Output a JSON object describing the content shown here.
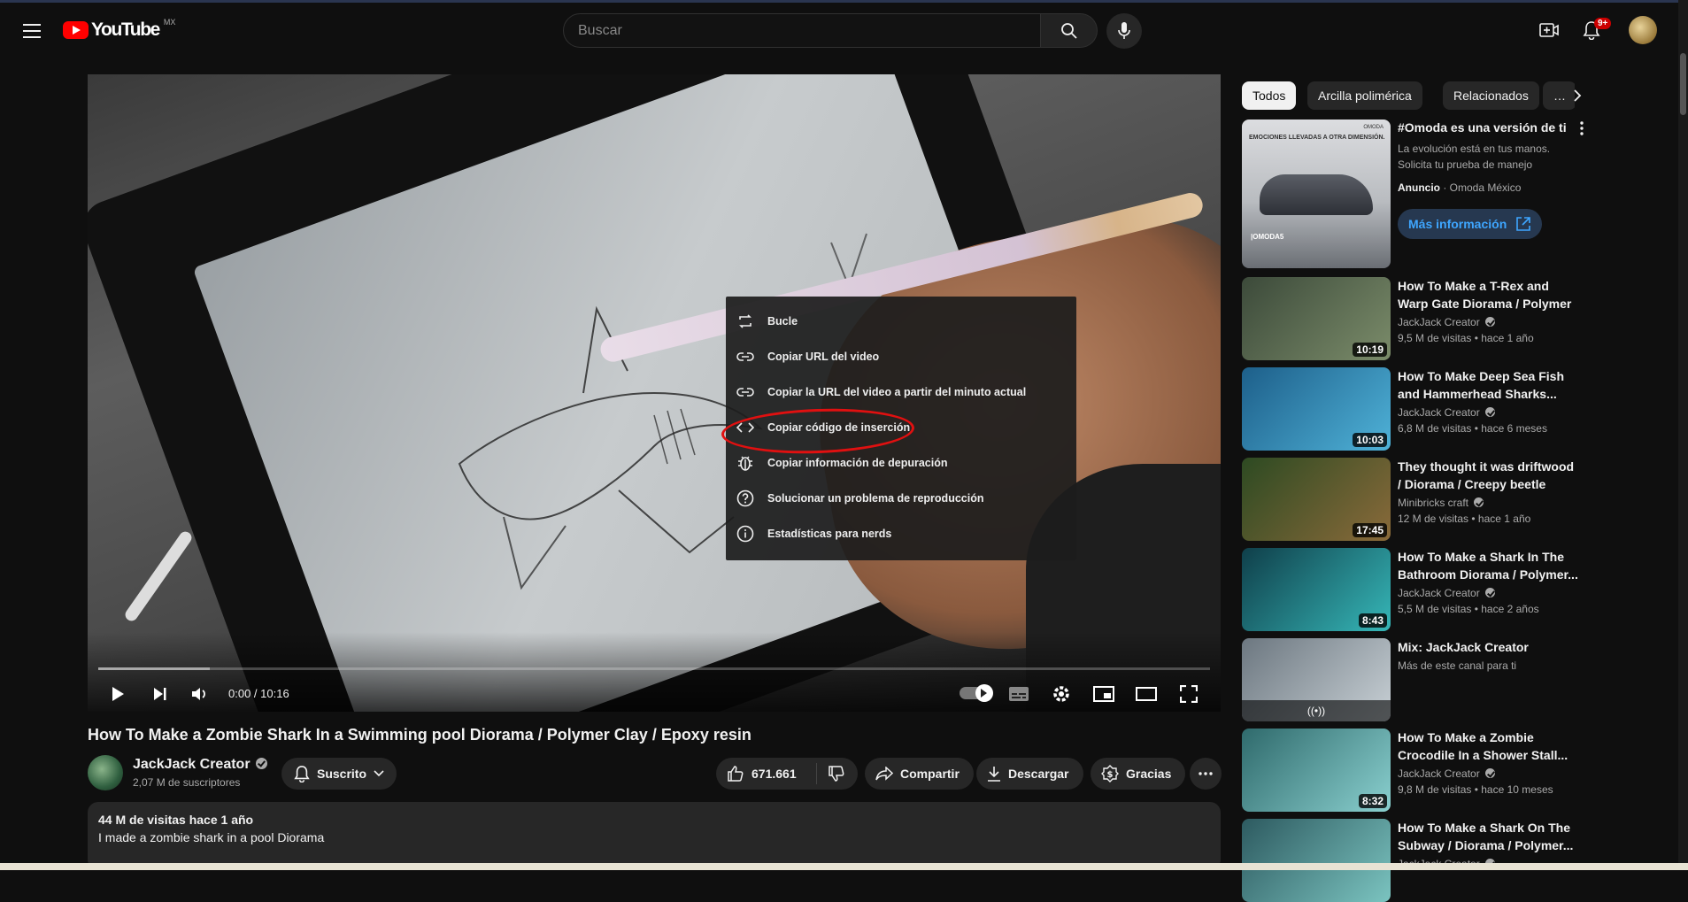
{
  "header": {
    "logo_text": "YouTube",
    "country_code": "MX",
    "search_placeholder": "Buscar",
    "notification_badge": "9+"
  },
  "player": {
    "time_current": "0:00",
    "time_separator": " / ",
    "time_total": "10:16",
    "progress_fraction": 0.0,
    "context_menu": [
      {
        "icon": "loop-icon",
        "label": "Bucle"
      },
      {
        "icon": "link-icon",
        "label": "Copiar URL del video"
      },
      {
        "icon": "link-icon",
        "label": "Copiar la URL del video a partir del minuto actual"
      },
      {
        "icon": "embed-code-icon",
        "label": "Copiar código de inserción"
      },
      {
        "icon": "debug-bug-icon",
        "label": "Copiar información de depuración"
      },
      {
        "icon": "help-circle-icon",
        "label": "Solucionar un problema de reproducción"
      },
      {
        "icon": "info-icon",
        "label": "Estadísticas para nerds"
      }
    ],
    "highlight_color": "#e01010"
  },
  "video": {
    "title": "How To Make a Zombie Shark In a Swimming pool Diorama / Polymer Clay / Epoxy resin",
    "channel": "JackJack Creator",
    "subscribers": "2,07 M de suscriptores",
    "subscribe_label": "Suscrito",
    "likes": "671.661",
    "share_label": "Compartir",
    "download_label": "Descargar",
    "thanks_label": "Gracias",
    "description_meta": "44 M de visitas  hace 1 año",
    "description_text": "I made a zombie shark in a pool Diorama"
  },
  "sidebar": {
    "chips": [
      "Todos",
      "Arcilla polimérica",
      "Relacionados",
      "…"
    ],
    "ad": {
      "title": "#Omoda es una versión de ti",
      "description": "La evolución está en tus manos. Solicita tu prueba de manejo",
      "label": "Anuncio",
      "advertiser": "Omoda México",
      "cta": "Más información",
      "thumb_tag": "EMOCIONES LLEVADAS A OTRA DIMENSIÓN.",
      "thumb_brand": "OMODA",
      "thumb_bottom": "|OMODA5"
    },
    "recommendations": [
      {
        "title": "How To Make a T-Rex and Warp Gate Diorama / Polymer Clay /...",
        "channel": "JackJack Creator",
        "verified": true,
        "meta": "9,5 M de visitas • hace 1 año",
        "duration": "10:19",
        "thumb_colors": [
          "#3c4a3a",
          "#7b8c6a"
        ]
      },
      {
        "title": "How To Make Deep Sea Fish and Hammerhead Sharks...",
        "channel": "JackJack Creator",
        "verified": true,
        "meta": "6,8 M de visitas • hace 6 meses",
        "duration": "10:03",
        "thumb_colors": [
          "#1d5f8a",
          "#4fb2d8"
        ]
      },
      {
        "title": "They thought it was driftwood / Diorama / Creepy beetle",
        "channel": "Minibricks craft",
        "verified": true,
        "meta": "12 M de visitas • hace 1 año",
        "duration": "17:45",
        "thumb_colors": [
          "#2d4a22",
          "#8a6a3a"
        ]
      },
      {
        "title": "How To Make a Shark In The Bathroom Diorama / Polymer...",
        "channel": "JackJack Creator",
        "verified": true,
        "meta": "5,5 M de visitas • hace 2 años",
        "duration": "8:43",
        "thumb_colors": [
          "#0f3f4a",
          "#36b7b8"
        ]
      },
      {
        "title": "Mix: JackJack Creator",
        "channel": "",
        "verified": false,
        "meta": "",
        "duration": "",
        "mix_sub": "Más de este canal para ti",
        "mix": true,
        "thumb_colors": [
          "#6c7780",
          "#c9d1d6"
        ]
      },
      {
        "title": "How To Make a Zombie Crocodile In a Shower Stall...",
        "channel": "JackJack Creator",
        "verified": true,
        "meta": "9,8 M de visitas • hace 10 meses",
        "duration": "8:32",
        "thumb_colors": [
          "#2f6a6c",
          "#8ad0cf"
        ]
      },
      {
        "title": "How To Make a Shark On The Subway / Diorama / Polymer...",
        "channel": "JackJack Creator",
        "verified": true,
        "meta": "",
        "duration": "",
        "thumb_colors": [
          "#2d5a60",
          "#7bc4c0"
        ]
      }
    ]
  }
}
